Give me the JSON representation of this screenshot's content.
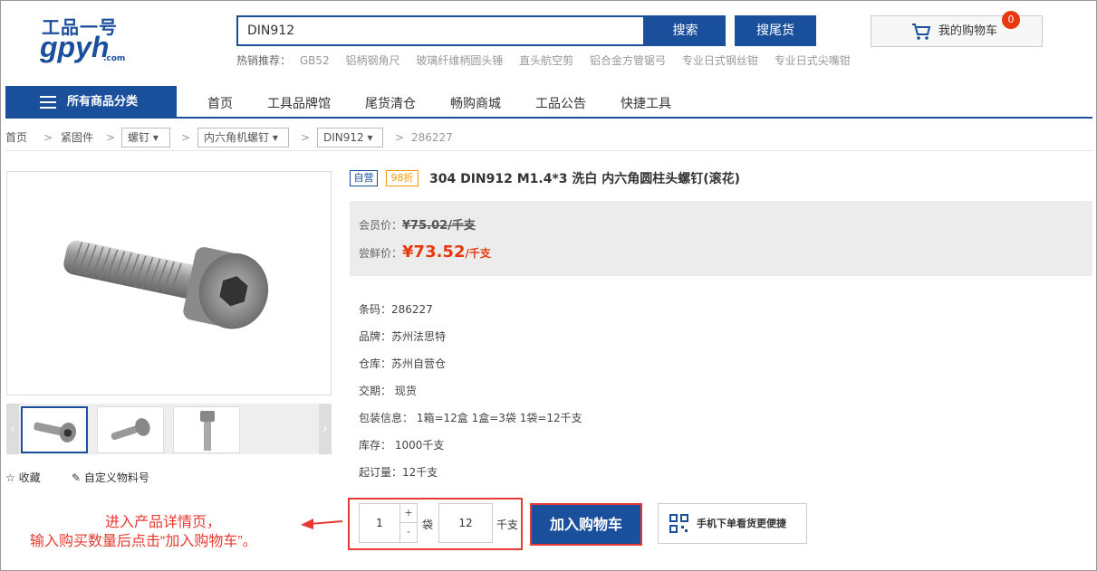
{
  "logo": {
    "cn": "工品一号",
    "en": "gpyh",
    "com": ".com"
  },
  "search": {
    "value": "DIN912",
    "button": "搜索",
    "tail_button": "搜尾货"
  },
  "hot": {
    "label": "热销推荐：",
    "items": [
      "GB52",
      "铝柄钢角尺",
      "玻璃纤维柄圆头锤",
      "直头航空剪",
      "铝合金方管锯弓",
      "专业日式钢丝钳",
      "专业日式尖嘴钳"
    ]
  },
  "cart": {
    "label": "我的购物车",
    "count": "0"
  },
  "nav": {
    "all": "所有商品分类",
    "items": [
      "首页",
      "工具品牌馆",
      "尾货清仓",
      "畅购商城",
      "工品公告",
      "快捷工具"
    ]
  },
  "breadcrumb": {
    "home": "首页",
    "sep": ">",
    "c1": "紧固件",
    "c2": "螺钉",
    "c3": "内六角机螺钉",
    "c4": "DIN912",
    "c5": "286227"
  },
  "product": {
    "tag_self": "自营",
    "tag_discount": "98折",
    "title": "304  DIN912  M1.4*3  洗白  内六角圆柱头螺钉(滚花)",
    "member_label": "会员价：",
    "member_price": "¥75.02",
    "member_unit": "/千支",
    "fresh_label": "尝鲜价：",
    "fresh_price": "¥73.52",
    "fresh_unit": "/千支",
    "info": [
      "条码：286227",
      "品牌：苏州法思特",
      "仓库：苏州自营仓",
      "交期：  现货",
      "包装信息：  1箱=12盒    1盒=3袋    1袋=12千支",
      "库存：  1000千支",
      "起订量：12千支"
    ]
  },
  "actions": {
    "fav": "收藏",
    "custom": "自定义物料号"
  },
  "buy": {
    "qty1": "1",
    "plus": "+",
    "minus": "-",
    "unit1": "袋",
    "qty2": "12",
    "unit2": "千支",
    "add_cart": "加入购物车",
    "mobile": "手机下单看货更便捷"
  },
  "annotation": {
    "line1": "进入产品详情页，",
    "line2": "输入购买数量后点击“加入购物车”。"
  },
  "colors": {
    "brand": "#1a4f9c",
    "accent_red": "#e8380d",
    "annotation": "#e63a32",
    "discount": "#f39800"
  }
}
